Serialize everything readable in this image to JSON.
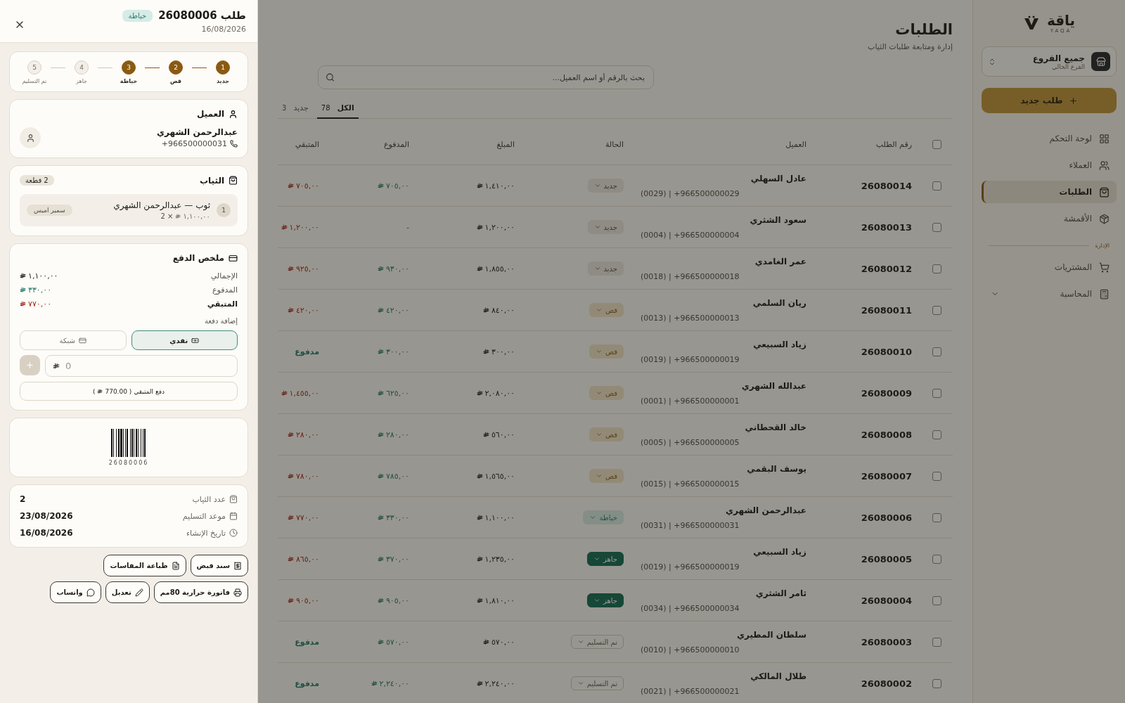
{
  "drawer": {
    "title": "طلب 26080006",
    "status": {
      "label": "خياطة",
      "kind": "sewing"
    },
    "date": "16/08/2026",
    "steps": [
      {
        "number": "1",
        "label": "جديد",
        "done": true
      },
      {
        "number": "2",
        "label": "قص",
        "done": true
      },
      {
        "number": "3",
        "label": "خياطة",
        "done": true
      },
      {
        "number": "4",
        "label": "جاهز",
        "done": false
      },
      {
        "number": "5",
        "label": "تم التسليم",
        "done": false
      }
    ],
    "customer": {
      "heading": "العميل",
      "name": "عبدالرحمن الشهري",
      "phone": "+966500000031"
    },
    "garments": {
      "heading": "الثياب",
      "count": "2 قطعة",
      "items": [
        {
          "index": "1",
          "title": "ثوب — عبدالرحمن الشهري",
          "price": "١,١٠٠,٠٠",
          "quantity": "× 2",
          "tag": "سمير اميس"
        }
      ]
    },
    "payment": {
      "heading": "ملخص الدفع",
      "rows": [
        {
          "label": "الإجمالي",
          "value": "١,١٠٠,٠٠",
          "kind": "total"
        },
        {
          "label": "المدفوع",
          "value": "٣٣٠,٠٠",
          "kind": "paid"
        },
        {
          "label": "المتبقي",
          "value": "٧٧٠,٠٠",
          "kind": "remaining"
        }
      ],
      "add_label": "إضافة دفعة",
      "methods": [
        {
          "label": "نقدي",
          "selected": true
        },
        {
          "label": "شبكة",
          "selected": false
        }
      ],
      "amount_placeholder": "0",
      "pay_rest": {
        "label": "دفع المتبقي ( 770.00",
        "close": ")"
      }
    },
    "barcode": "26080006",
    "info": [
      {
        "label": "عدد الثياب",
        "value": "2"
      },
      {
        "label": "موعد التسليم",
        "value": "23/08/2026"
      },
      {
        "label": "تاريخ الإنشاء",
        "value": "16/08/2026"
      }
    ],
    "actions": [
      {
        "label": "سند قبض"
      },
      {
        "label": "طباعة المقاسات"
      },
      {
        "label": "فاتورة حرارية 80مم"
      },
      {
        "label": "تعديل"
      },
      {
        "label": "واتساب"
      }
    ]
  },
  "sidebar": {
    "logo": {
      "name": "ياقة",
      "latin": "YAQA"
    },
    "branch": {
      "name": "جميع الفروع",
      "caption": "الفرع الحالي"
    },
    "new_order": "طلب جديد",
    "items": [
      {
        "label": "لوحة التحكم",
        "selected": false
      },
      {
        "label": "العملاء",
        "selected": false
      },
      {
        "label": "الطلبات",
        "selected": true
      },
      {
        "label": "الأقمشة",
        "selected": false
      }
    ],
    "section": "الإدارة",
    "admin_items": [
      {
        "label": "المشتريات"
      },
      {
        "label": "المحاسبة",
        "expanded": false
      }
    ]
  },
  "page": {
    "title": "الطلبات",
    "subtitle": "إدارة ومتابعة طلبات الثياب",
    "search_placeholder": "بحث بالرقم أو اسم العميل...",
    "tabs": [
      {
        "label": "الكل",
        "count": "78",
        "selected": true
      },
      {
        "label": "جديد",
        "count": "3",
        "selected": false
      }
    ]
  },
  "table": {
    "all_checked": false,
    "columns": [
      "رقم الطلب",
      "العميل",
      "الحالة",
      "المبلغ",
      "المدفوع",
      "المتبقي"
    ],
    "rows": [
      {
        "number": "26080014",
        "customer": "عادل السهلي",
        "phone": "(0029) | +966500000029",
        "status": {
          "label": "جديد",
          "kind": "new"
        },
        "amount": "١,٤١٠,٠٠",
        "paid": {
          "kind": "amount",
          "text": "٧٠٥,٠٠"
        },
        "remaining": {
          "kind": "amount",
          "text": "٧٠٥,٠٠"
        },
        "checked": false
      },
      {
        "number": "26080013",
        "customer": "سعود الشثري",
        "phone": "(0004) | +966500000004",
        "status": {
          "label": "جديد",
          "kind": "new"
        },
        "amount": "١,٢٠٠,٠٠",
        "paid": {
          "kind": "none",
          "text": "-"
        },
        "remaining": {
          "kind": "amount",
          "text": "١,٢٠٠,٠٠"
        },
        "checked": false
      },
      {
        "number": "26080012",
        "customer": "عمر الغامدي",
        "phone": "(0018) | +966500000018",
        "status": {
          "label": "جديد",
          "kind": "new"
        },
        "amount": "١,٨٥٥,٠٠",
        "paid": {
          "kind": "amount",
          "text": "٩٣٠,٠٠"
        },
        "remaining": {
          "kind": "amount",
          "text": "٩٢٥,٠٠"
        },
        "checked": false
      },
      {
        "number": "26080011",
        "customer": "ريان السلمي",
        "phone": "(0013) | +966500000013",
        "status": {
          "label": "قص",
          "kind": "cut"
        },
        "amount": "٨٤٠,٠٠",
        "paid": {
          "kind": "amount",
          "text": "٤٢٠,٠٠"
        },
        "remaining": {
          "kind": "amount",
          "text": "٤٢٠,٠٠"
        },
        "checked": false
      },
      {
        "number": "26080010",
        "customer": "زياد السبيعي",
        "phone": "(0019) | +966500000019",
        "status": {
          "label": "قص",
          "kind": "cut"
        },
        "amount": "٣٠٠,٠٠",
        "paid": {
          "kind": "amount",
          "text": "٣٠٠,٠٠"
        },
        "remaining": {
          "kind": "paid",
          "text": "مدفوع"
        },
        "checked": false
      },
      {
        "number": "26080009",
        "customer": "عبدالله الشهري",
        "phone": "(0001) | +966500000001",
        "status": {
          "label": "قص",
          "kind": "cut"
        },
        "amount": "٢,٠٨٠,٠٠",
        "paid": {
          "kind": "amount",
          "text": "٦٢٥,٠٠"
        },
        "remaining": {
          "kind": "amount",
          "text": "١,٤٥٥,٠٠"
        },
        "checked": false
      },
      {
        "number": "26080008",
        "customer": "خالد القحطاني",
        "phone": "(0005) | +966500000005",
        "status": {
          "label": "قص",
          "kind": "cut"
        },
        "amount": "٥٦٠,٠٠",
        "paid": {
          "kind": "amount",
          "text": "٢٨٠,٠٠"
        },
        "remaining": {
          "kind": "amount",
          "text": "٢٨٠,٠٠"
        },
        "checked": false
      },
      {
        "number": "26080007",
        "customer": "يوسف البقمي",
        "phone": "(0015) | +966500000015",
        "status": {
          "label": "قص",
          "kind": "cut"
        },
        "amount": "١,٥٦٥,٠٠",
        "paid": {
          "kind": "amount",
          "text": "٧٨٥,٠٠"
        },
        "remaining": {
          "kind": "amount",
          "text": "٧٨٠,٠٠"
        },
        "checked": false
      },
      {
        "number": "26080006",
        "customer": "عبدالرحمن الشهري",
        "phone": "(0031) | +966500000031",
        "status": {
          "label": "خياطة",
          "kind": "sewing"
        },
        "amount": "١,١٠٠,٠٠",
        "paid": {
          "kind": "amount",
          "text": "٣٣٠,٠٠"
        },
        "remaining": {
          "kind": "amount",
          "text": "٧٧٠,٠٠"
        },
        "checked": false
      },
      {
        "number": "26080005",
        "customer": "زياد السبيعي",
        "phone": "(0019) | +966500000019",
        "status": {
          "label": "جاهز",
          "kind": "ready"
        },
        "amount": "١,٢٣٥,٠٠",
        "paid": {
          "kind": "amount",
          "text": "٣٧٠,٠٠"
        },
        "remaining": {
          "kind": "amount",
          "text": "٨٦٥,٠٠"
        },
        "checked": false
      },
      {
        "number": "26080004",
        "customer": "ثامر الشثري",
        "phone": "(0034) | +966500000034",
        "status": {
          "label": "جاهز",
          "kind": "ready"
        },
        "amount": "١,٨١٠,٠٠",
        "paid": {
          "kind": "amount",
          "text": "٩٠٥,٠٠"
        },
        "remaining": {
          "kind": "amount",
          "text": "٩٠٥,٠٠"
        },
        "checked": false
      },
      {
        "number": "26080003",
        "customer": "سلطان المطيري",
        "phone": "(0010) | +966500000010",
        "status": {
          "label": "تم التسليم",
          "kind": "delivered"
        },
        "amount": "٥٧٠,٠٠",
        "paid": {
          "kind": "amount",
          "text": "٥٧٠,٠٠"
        },
        "remaining": {
          "kind": "paid",
          "text": "مدفوع"
        },
        "checked": false
      },
      {
        "number": "26080002",
        "customer": "طلال المالكي",
        "phone": "(0021) | +966500000021",
        "status": {
          "label": "تم التسليم",
          "kind": "delivered"
        },
        "amount": "٢,٢٤٠,٠٠",
        "paid": {
          "kind": "amount",
          "text": "٢,٢٤٠,٠٠"
        },
        "remaining": {
          "kind": "paid",
          "text": "مدفوع"
        },
        "checked": false
      }
    ]
  }
}
